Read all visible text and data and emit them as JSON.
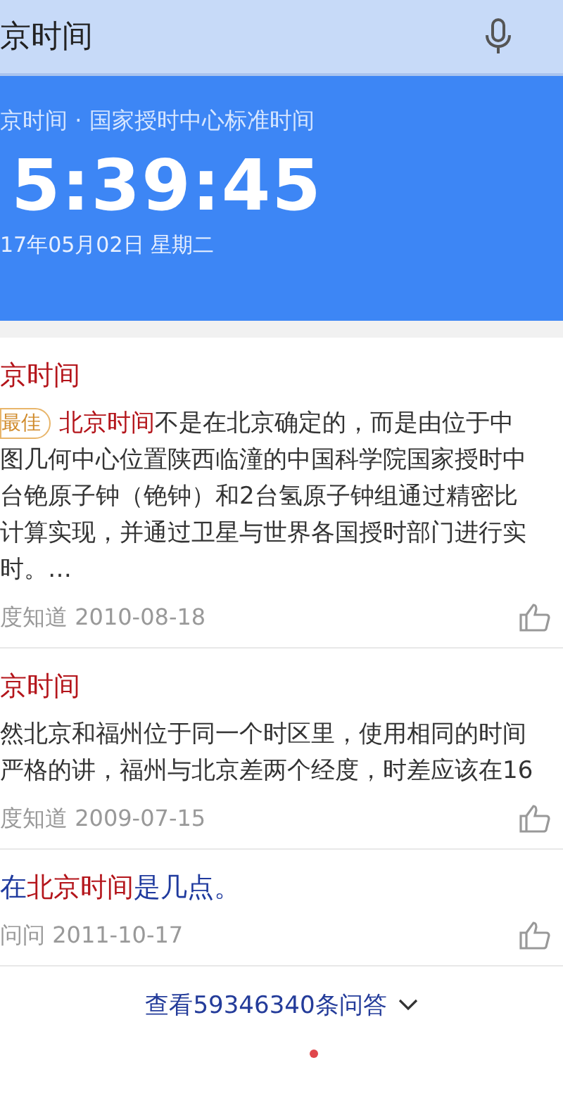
{
  "search": {
    "query": "京时间"
  },
  "time_card": {
    "subtitle": "京时间 · 国家授时中心标准时间",
    "time": "5:39:45",
    "date": "17年05月02日  星期二"
  },
  "results": [
    {
      "title": [
        {
          "text": "京时间",
          "highlight": true
        }
      ],
      "badge": "最佳",
      "body": [
        [
          {
            "text": "北京时间",
            "highlight": true
          },
          {
            "text": "不是在北京确定的，而是由位于中",
            "highlight": false
          }
        ],
        [
          {
            "text": "图几何中心位置陕西临潼的中国科学院国家授时中",
            "highlight": false
          }
        ],
        [
          {
            "text": "台铯原子钟（铯钟）和2台氢原子钟组通过精密比",
            "highlight": false
          }
        ],
        [
          {
            "text": "计算实现，并通过卫星与世界各国授时部门进行实",
            "highlight": false
          }
        ],
        [
          {
            "text": "时。…",
            "highlight": false
          }
        ]
      ],
      "source": "度知道 2010-08-18"
    },
    {
      "title": [
        {
          "text": "京时间",
          "highlight": true
        }
      ],
      "body": [
        [
          {
            "text": "然北京和福州位于同一个时区里，使用相同的时间",
            "highlight": false
          }
        ],
        [
          {
            "text": "严格的讲，福州与北京差两个经度，时差应该在16",
            "highlight": false
          }
        ]
      ],
      "source": "度知道 2009-07-15"
    },
    {
      "title": [
        {
          "text": "在",
          "highlight": false
        },
        {
          "text": "北京时间",
          "highlight": true
        },
        {
          "text": "是几点。",
          "highlight": false
        }
      ],
      "source": "问问 2011-10-17"
    }
  ],
  "more_link": "查看59346340条问答"
}
